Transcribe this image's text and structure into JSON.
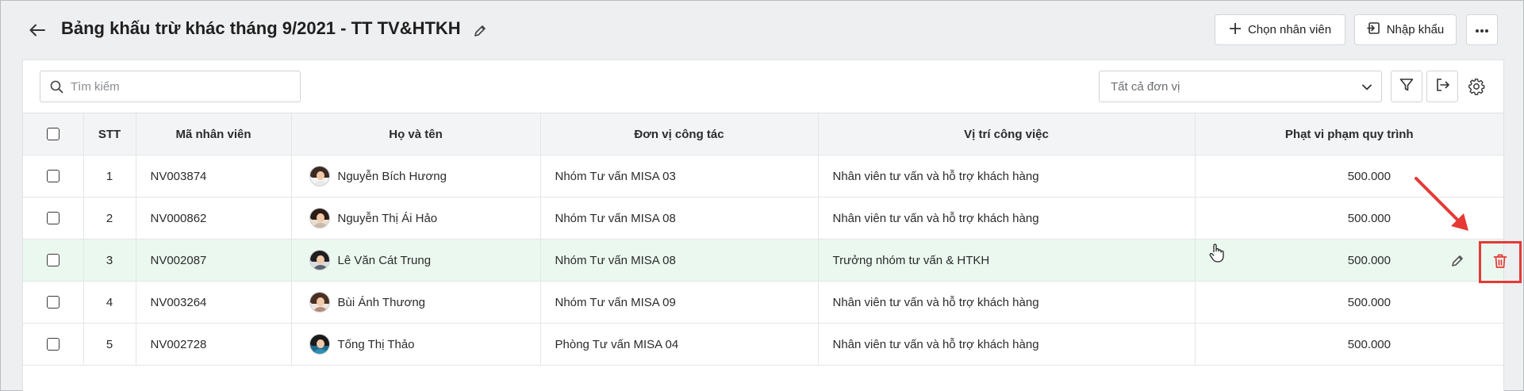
{
  "header": {
    "title": "Bảng khấu trừ khác tháng 9/2021 - TT TV&HTKH",
    "buttons": {
      "choose_employee": "Chọn nhân viên",
      "import": "Nhập khẩu"
    }
  },
  "toolbar": {
    "search_placeholder": "Tìm kiếm",
    "unit_select_value": "Tất cả đơn vị"
  },
  "table": {
    "columns": [
      "STT",
      "Mã nhân viên",
      "Họ và tên",
      "Đơn vị công tác",
      "Vị trí công việc",
      "Phạt vi phạm quy trình"
    ],
    "rows": [
      {
        "stt": "1",
        "code": "NV003874",
        "name": "Nguyễn Bích Hương",
        "unit": "Nhóm Tư vấn MISA 03",
        "position": "Nhân viên tư vấn và hỗ trợ khách hàng",
        "fine": "500.000"
      },
      {
        "stt": "2",
        "code": "NV000862",
        "name": "Nguyễn Thị Ái Hảo",
        "unit": "Nhóm Tư vấn MISA 08",
        "position": "Nhân viên tư vấn và hỗ trợ khách hàng",
        "fine": "500.000"
      },
      {
        "stt": "3",
        "code": "NV002087",
        "name": "Lê Văn Cát Trung",
        "unit": "Nhóm Tư vấn MISA 08",
        "position": "Trưởng nhóm tư vấn & HTKH",
        "fine": "500.000"
      },
      {
        "stt": "4",
        "code": "NV003264",
        "name": "Bùi Ánh Thương",
        "unit": "Nhóm Tư vấn MISA 09",
        "position": "Nhân viên tư vấn và hỗ trợ khách hàng",
        "fine": "500.000"
      },
      {
        "stt": "5",
        "code": "NV002728",
        "name": "Tống Thị Thảo",
        "unit": "Phòng Tư vấn MISA 04",
        "position": "Nhân viên tư vấn và hỗ trợ khách hàng",
        "fine": "500.000"
      }
    ]
  },
  "colors": {
    "highlight_row": "#ebf8ef",
    "annotation_red": "#e53935"
  },
  "icons": [
    "back-arrow-icon",
    "pencil-icon",
    "plus-icon",
    "import-icon",
    "more-icon",
    "search-icon",
    "chevron-down-icon",
    "filter-icon",
    "export-icon",
    "gear-icon",
    "trash-icon"
  ]
}
